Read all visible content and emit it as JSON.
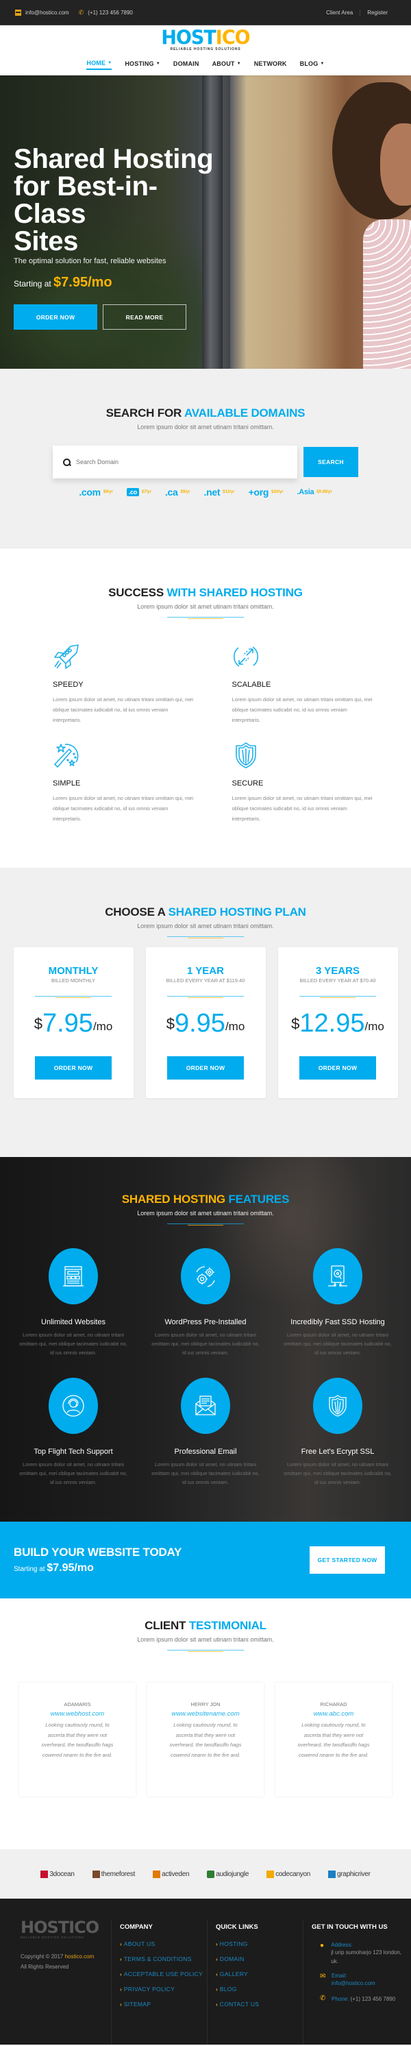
{
  "topbar": {
    "email": "info@hostico.com",
    "phone": "(+1) 123 456 7890",
    "links": [
      "Client Area",
      "Register"
    ]
  },
  "brand": {
    "name_part1": "HOST",
    "name_part2": "ICO",
    "tagline": "RELIABLE HOSTING SOLUTIONS",
    "colors": {
      "primary": "#00aced",
      "accent": "#ffb400",
      "dark": "#1c1c1c"
    }
  },
  "nav": [
    {
      "label": "HOME",
      "dropdown": true,
      "active": true
    },
    {
      "label": "HOSTING",
      "dropdown": true
    },
    {
      "label": "DOMAIN",
      "dropdown": false
    },
    {
      "label": "ABOUT",
      "dropdown": true
    },
    {
      "label": "NETWORK",
      "dropdown": false
    },
    {
      "label": "BLOG",
      "dropdown": true
    }
  ],
  "hero": {
    "title_lines": [
      "Shared Hosting",
      "for Best-in-Class",
      "Sites"
    ],
    "subtitle": "The optimal solution for fast, reliable websites",
    "starting_label": "Starting at",
    "starting_price": "$7.95/mo",
    "primary_button": "ORDER NOW",
    "secondary_button": "READ MORE"
  },
  "domain_search": {
    "title_dark": "SEARCH FOR",
    "title_blue": "AVAILABLE DOMAINS",
    "subtitle": "Lorem ipsum dolor sit amet utinam tritani omittam.",
    "placeholder": "Search Domain",
    "value": "",
    "button": "SEARCH",
    "tlds": [
      {
        "ext": ".com",
        "price": "$9/yr"
      },
      {
        "ext": ".co",
        "price": "$7/yr"
      },
      {
        "ext": ".ca",
        "price": "$9/yr"
      },
      {
        "ext": ".net",
        "price": "$12/yr"
      },
      {
        "ext": "+org",
        "price": "$20/yr"
      },
      {
        "ext": ".Asia",
        "price": "$9.99/yr"
      }
    ]
  },
  "success": {
    "title_dark": "SUCCESS",
    "title_blue": "WITH SHARED HOSTING",
    "subtitle": "Lorem ipsum dolor sit amet utinam tritani omittam.",
    "items": [
      {
        "icon": "rocket-icon",
        "title": "SPEEDY",
        "text": "Lorem ipsum dolor sit amet, no utinam tritani omittam qui, mei oblique tacimates iudicabit no, id ius omnis veniam interpretaris."
      },
      {
        "icon": "sync-arrows-icon",
        "title": "SCALABLE",
        "text": "Lorem ipsum dolor sit amet, no utinam tritani omittam qui, mei oblique tacimates iudicabit no, id ius omnis veniam interpretaris."
      },
      {
        "icon": "magic-wand-icon",
        "title": "SIMPLE",
        "text": "Lorem ipsum dolor sit amet, no utinam tritani omittam qui, mei oblique tacimates iudicabit no, id ius omnis veniam interpretaris."
      },
      {
        "icon": "shield-icon",
        "title": "SECURE",
        "text": "Lorem ipsum dolor sit amet, no utinam tritani omittam qui, mei oblique tacimates iudicabit no, id ius omnis veniam interpretaris."
      }
    ]
  },
  "plans": {
    "title_dark": "CHOOSE A",
    "title_blue": "SHARED HOSTING PLAN",
    "subtitle": "Lorem ipsum dolor sit amet utinam tritani omittam.",
    "items": [
      {
        "name": "MONTHLY",
        "billed": "BILLED MONTHLY",
        "currency": "$",
        "price": "7.95",
        "period": "/mo",
        "button": "ORDER NOW"
      },
      {
        "name": "1 YEAR",
        "billed": "BILLED EVERY YEAR AT $119.40",
        "currency": "$",
        "price": "9.95",
        "period": "/mo",
        "button": "ORDER NOW"
      },
      {
        "name": "3 YEARS",
        "billed": "BILLED EVERY YEAR AT $70.40",
        "currency": "$",
        "price": "12.95",
        "period": "/mo",
        "button": "ORDER NOW"
      }
    ]
  },
  "features": {
    "title_yellow": "SHARED HOSTING",
    "title_blue": "FEATURES",
    "subtitle": "Lorem ipsum dolor sit amet utinam tritani omittam.",
    "items": [
      {
        "icon": "website-layout-icon",
        "title": "Unlimited Websites",
        "text": "Lorem ipsum dolor sit amet, no utinam tritani omittam qui, mei oblique tacimates iudicabit no, id ius omnis veniam."
      },
      {
        "icon": "gears-icon",
        "title": "WordPress Pre-Installed",
        "text": "Lorem ipsum dolor sit amet, no utinam tritani omittam qui, mei oblique tacimates iudicabit no, id ius omnis veniam."
      },
      {
        "icon": "ssd-drive-icon",
        "title": "Incredibly Fast SSD Hosting",
        "text": "Lorem ipsum dolor sit amet, no utinam tritani omittam qui, mei oblique tacimates iudicabit no, id ius omnis veniam."
      },
      {
        "icon": "support-agent-icon",
        "title": "Top Flight Tech Support",
        "text": "Lorem ipsum dolor sit amet, no utinam tritani omittam qui, mei oblique tacimates iudicabit no, id ius omnis veniam."
      },
      {
        "icon": "email-envelope-icon",
        "title": "Professional Email",
        "text": "Lorem ipsum dolor sit amet, no utinam tritani omittam qui, mei oblique tacimates iudicabit no, id ius omnis veniam."
      },
      {
        "icon": "ssl-shield-icon",
        "title": "Free Let's Ecrypt SSL",
        "text": "Lorem ipsum dolor sit amet, no utinam tritani omittam qui, mei oblique tacimates iudicabit no, id ius omnis veniam."
      }
    ]
  },
  "cta": {
    "title": "BUILD YOUR WEBSITE TODAY",
    "starting_label": "Starting at",
    "price": "$7.95/mo",
    "button": "GET STARTED NOW"
  },
  "testimonials": {
    "title_dark": "CLIENT",
    "title_blue": "TESTIMONIAL",
    "subtitle": "Lorem ipsum dolor sit amet utinam tritani omittam.",
    "items": [
      {
        "name": "ADAMARIS",
        "site": "www.webhost.com",
        "quote": "Looking cautiously round, to ascerta that they were not overheard, the twsdfasdfo hags cowered nearer to the fire and."
      },
      {
        "name": "HERRY JON",
        "site": "www.websitename.com",
        "quote": "Looking cautiously round, to ascerta that they were not overheard, the twsdfasdfo hags cowered nearer to the fire and."
      },
      {
        "name": "RICHARAD",
        "site": "www.abc.com",
        "quote": "Looking cautiously round, to ascerta that they were not overheard, the twsdfasdfo hags cowered nearer to the fire and."
      }
    ]
  },
  "partners": [
    {
      "name": "3docean",
      "color": "#c8102e"
    },
    {
      "name": "themeforest",
      "color": "#7a4a2a"
    },
    {
      "name": "activeden",
      "color": "#e07b00"
    },
    {
      "name": "audiojungle",
      "color": "#2f7d32"
    },
    {
      "name": "codecanyon",
      "color": "#f2a900"
    },
    {
      "name": "graphicriver",
      "color": "#1c7fc4"
    }
  ],
  "footer": {
    "logo": "HOSTICO",
    "tagline": "RELIABLE HOSTING SOLUTIONS",
    "copyright_prefix": "Copyright © 2017",
    "copyright_link": "hostico.com",
    "rights": "All Rights Reserved",
    "company": {
      "title": "COMPANY",
      "links": [
        "ABOUT US",
        "TERMS & CONDITIONS",
        "ACCEPTABLE USE POLICY",
        "PRIVACY POLICY",
        "SITEMAP"
      ]
    },
    "quick_links": {
      "title": "QUICK LINKS",
      "links": [
        "HOSTING",
        "DOMAIN",
        "GALLERY",
        "BLOG",
        "CONTACT US"
      ]
    },
    "contact": {
      "title": "GET IN TOUCH WITH US",
      "address_label": "Address:",
      "address": "jl urip sumoharjo 123 london, uk.",
      "email_label": "Email:",
      "email": "info@hostico.com",
      "phone_label": "Phone:",
      "phone": "(+1) 123 456 7890"
    }
  }
}
